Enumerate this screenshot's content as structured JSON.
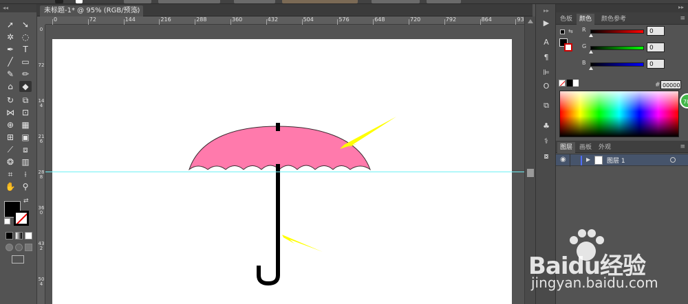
{
  "document": {
    "tab_title": "未标题-1* @ 95% (RGB/预览)",
    "close_glyph": "×"
  },
  "rulers": {
    "horizontal": [
      "0",
      "72",
      "144",
      "216",
      "288",
      "360",
      "432",
      "504",
      "576",
      "648",
      "720",
      "792",
      "864",
      "936"
    ],
    "vertical": [
      "0",
      "72",
      "144",
      "216",
      "288",
      "360",
      "432",
      "504"
    ]
  },
  "color_panel": {
    "tabs": [
      "色板",
      "颜色",
      "颜色参考"
    ],
    "active_tab": "颜色",
    "channels": [
      {
        "label": "R",
        "value": "0",
        "track_from": "#000000",
        "track_to": "#ff0000"
      },
      {
        "label": "G",
        "value": "0",
        "track_from": "#000000",
        "track_to": "#00ff00"
      },
      {
        "label": "B",
        "value": "0",
        "track_from": "#000000",
        "track_to": "#0000ff"
      }
    ],
    "hex_label": "#",
    "hex_value": "000000"
  },
  "layers_panel": {
    "tabs": [
      "图层",
      "画板",
      "外观"
    ],
    "active_tab": "图层",
    "layers": [
      {
        "name": "图层 1",
        "color": "#4f6dff"
      }
    ]
  },
  "badge": {
    "text": "70"
  },
  "illustration": {
    "umbrella_canopy_color": "#ff7aac",
    "handle_color": "#000000",
    "arrow_color": "#ffff00"
  },
  "guide_color": "#6ef0f5",
  "watermark": {
    "brand": "Baidu经验",
    "site": "jingyan.baidu.com"
  }
}
